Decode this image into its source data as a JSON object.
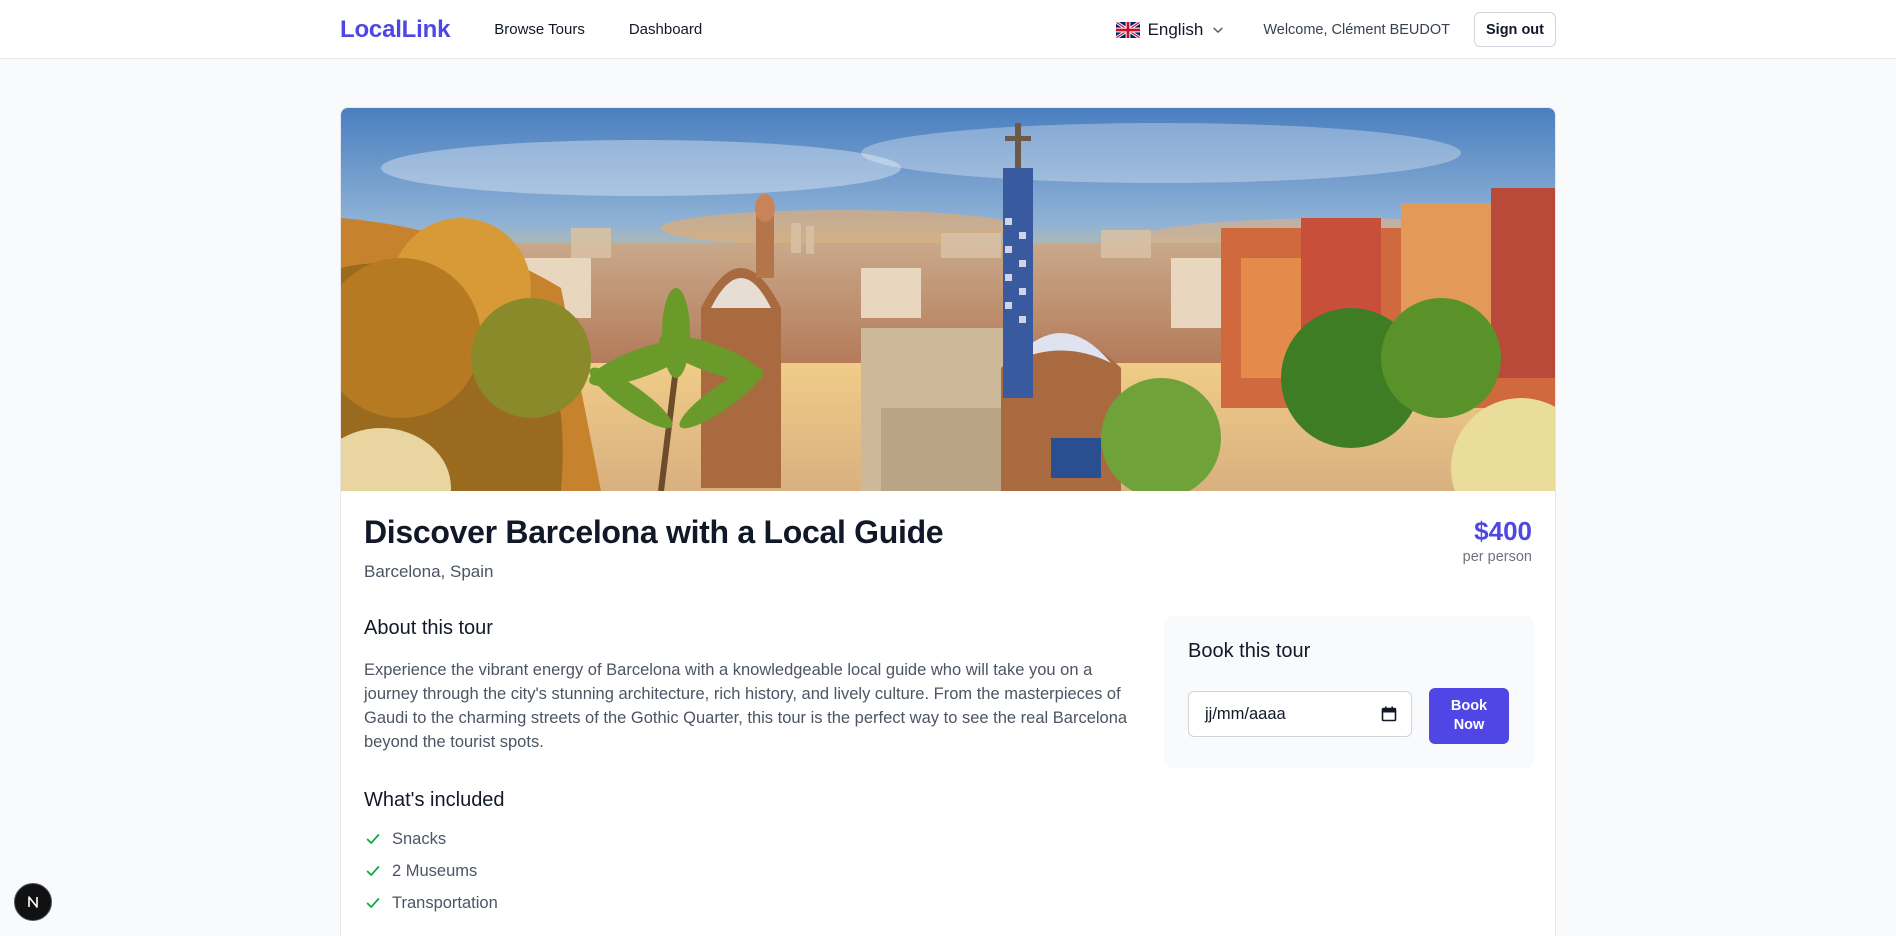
{
  "header": {
    "logo": "LocalLink",
    "nav": [
      {
        "label": "Browse Tours"
      },
      {
        "label": "Dashboard"
      }
    ],
    "language": {
      "label": "English",
      "icon": "uk-flag-icon"
    },
    "welcome": "Welcome, Clément BEUDOT",
    "signout_label": "Sign out"
  },
  "tour": {
    "hero_alt": "Park Güell, Barcelona",
    "title": "Discover Barcelona with a Local Guide",
    "location": "Barcelona, Spain",
    "price": "$400",
    "price_unit": "per person",
    "about_heading": "About this tour",
    "description": "Experience the vibrant energy of Barcelona with a knowledgeable local guide who will take you on a journey through the city's stunning architecture, rich history, and lively culture. From the masterpieces of Gaudi to the charming streets of the Gothic Quarter, this tour is the perfect way to see the real Barcelona beyond the tourist spots.",
    "included_heading": "What's included",
    "included": [
      "Snacks",
      "2 Museums",
      "Transportation"
    ]
  },
  "booking": {
    "heading": "Book this tour",
    "date_placeholder": "jj/mm/aaaa",
    "button_label": "Book\nNow"
  },
  "colors": {
    "accent": "#4f46e5",
    "check": "#16a34a"
  }
}
